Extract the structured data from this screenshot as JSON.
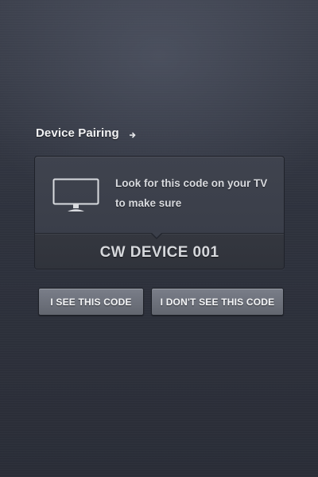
{
  "header": {
    "title": "Device Pairing",
    "arrow_icon": "arrow-right-icon"
  },
  "card": {
    "icon": "tv-icon",
    "message": "Look for this code on your TV to make sure",
    "code": "CW DEVICE 001"
  },
  "actions": {
    "confirm_label": "I SEE THIS CODE",
    "deny_label": "I DON'T SEE THIS CODE"
  },
  "colors": {
    "background": "#2e323d",
    "card": "#3c404b",
    "button": "#6e727c",
    "text": "#f2f3f5"
  }
}
